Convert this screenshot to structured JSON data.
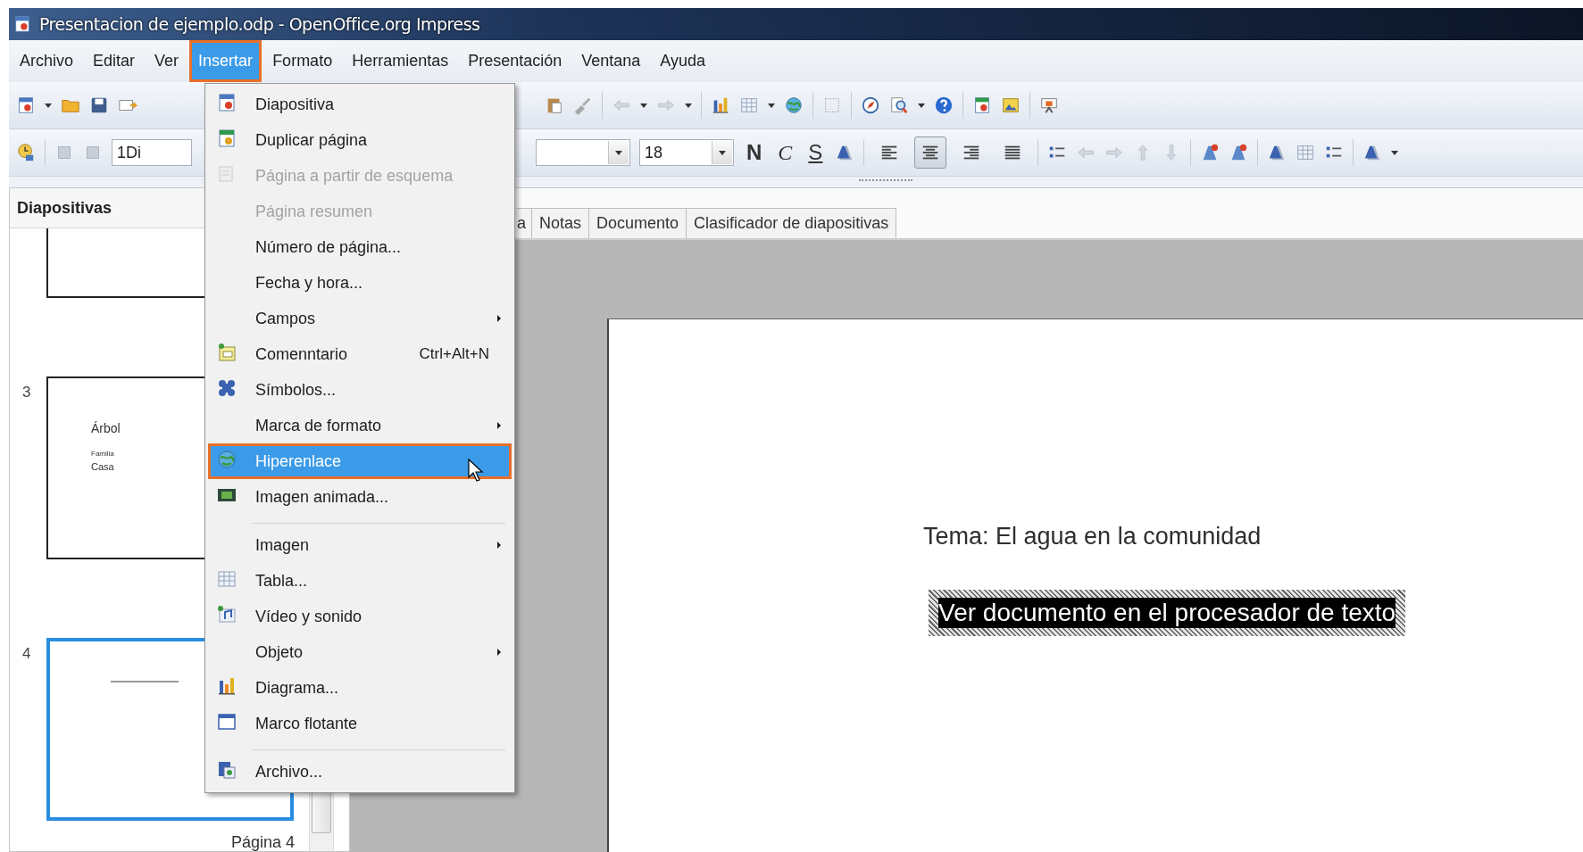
{
  "window": {
    "title": "Presentacion de ejemplo.odp - OpenOffice.org Impress"
  },
  "menu_bar": [
    {
      "label": "Archivo",
      "selected": false
    },
    {
      "label": "Editar",
      "selected": false
    },
    {
      "label": "Ver",
      "selected": false
    },
    {
      "label": "Insertar",
      "selected": true
    },
    {
      "label": "Formato",
      "selected": false
    },
    {
      "label": "Herramientas",
      "selected": false
    },
    {
      "label": "Presentación",
      "selected": false
    },
    {
      "label": "Ventana",
      "selected": false
    },
    {
      "label": "Ayuda",
      "selected": false
    }
  ],
  "format_toolbar": {
    "style_field": {
      "value": "1Di"
    },
    "font_size_field": {
      "value": "18"
    },
    "text_style_buttons": [
      {
        "label": "N",
        "kind": "bold"
      },
      {
        "label": "C",
        "kind": "italic"
      },
      {
        "label": "S",
        "kind": "underline"
      }
    ],
    "align_buttons": [
      {
        "selected": false
      },
      {
        "selected": true
      },
      {
        "selected": false
      },
      {
        "selected": false
      }
    ]
  },
  "slides_panel": {
    "title": "Diapositivas",
    "slides": [
      {
        "kind": "partial",
        "selected": false
      },
      {
        "kind": "full",
        "number": "3",
        "selected": false,
        "texts": [
          {
            "text": "Árbol",
            "kind": "heading"
          },
          {
            "text": "Familia",
            "kind": "small"
          },
          {
            "text": "Casa",
            "kind": "body"
          }
        ]
      },
      {
        "kind": "full",
        "number": "4",
        "selected": true,
        "caption": "Página 4"
      }
    ]
  },
  "view_tabs": [
    "a",
    "Notas",
    "Documento",
    "Clasificador de diapositivas"
  ],
  "slide": {
    "title": "Tema: El agua en la comunidad",
    "link_text": "Ver documento en el procesador de texto"
  },
  "insert_menu": {
    "items": [
      {
        "label": "Diapositiva",
        "kind": "slide",
        "disabled": false,
        "submenu": false,
        "selected": false,
        "separator_before": false
      },
      {
        "label": "Duplicar página",
        "kind": "duplicate",
        "disabled": false,
        "submenu": false,
        "selected": false,
        "separator_before": false
      },
      {
        "label": "Página a partir de esquema",
        "kind": "outline",
        "disabled": true,
        "submenu": false,
        "selected": false,
        "separator_before": false
      },
      {
        "label": "Página resumen",
        "disabled": true,
        "submenu": false,
        "selected": false,
        "separator_before": false
      },
      {
        "label": "Número de página...",
        "disabled": false,
        "submenu": false,
        "selected": false,
        "separator_before": false
      },
      {
        "label": "Fecha y hora...",
        "disabled": false,
        "submenu": false,
        "selected": false,
        "separator_before": false
      },
      {
        "label": "Campos",
        "disabled": false,
        "submenu": true,
        "selected": false,
        "separator_before": false
      },
      {
        "label": "Comenntario",
        "kind": "note",
        "shortcut": "Ctrl+Alt+N",
        "disabled": false,
        "submenu": false,
        "selected": false,
        "separator_before": false
      },
      {
        "label": "Símbolos...",
        "kind": "symbols",
        "disabled": false,
        "submenu": false,
        "selected": false,
        "separator_before": false
      },
      {
        "label": "Marca de formato",
        "disabled": false,
        "submenu": true,
        "selected": false,
        "separator_before": false
      },
      {
        "label": "Hiperenlace",
        "kind": "link",
        "disabled": false,
        "submenu": false,
        "selected": true,
        "separator_before": false
      },
      {
        "label": "Imagen animada...",
        "kind": "film",
        "disabled": false,
        "submenu": false,
        "selected": false,
        "separator_before": false
      },
      {
        "label": "Imagen",
        "disabled": false,
        "submenu": true,
        "selected": false,
        "separator_before": true
      },
      {
        "label": "Tabla...",
        "kind": "table",
        "disabled": false,
        "submenu": false,
        "selected": false,
        "separator_before": false
      },
      {
        "label": "Vídeo y sonido",
        "kind": "media",
        "disabled": false,
        "submenu": false,
        "selected": false,
        "separator_before": false
      },
      {
        "label": "Objeto",
        "disabled": false,
        "submenu": true,
        "selected": false,
        "separator_before": false
      },
      {
        "label": "Diagrama...",
        "kind": "chart",
        "disabled": false,
        "submenu": false,
        "selected": false,
        "separator_before": false
      },
      {
        "label": "Marco flotante",
        "kind": "frame",
        "disabled": false,
        "submenu": false,
        "selected": false,
        "separator_before": false
      },
      {
        "label": "Archivo...",
        "kind": "file",
        "disabled": false,
        "submenu": false,
        "selected": false,
        "separator_before": true
      }
    ]
  }
}
